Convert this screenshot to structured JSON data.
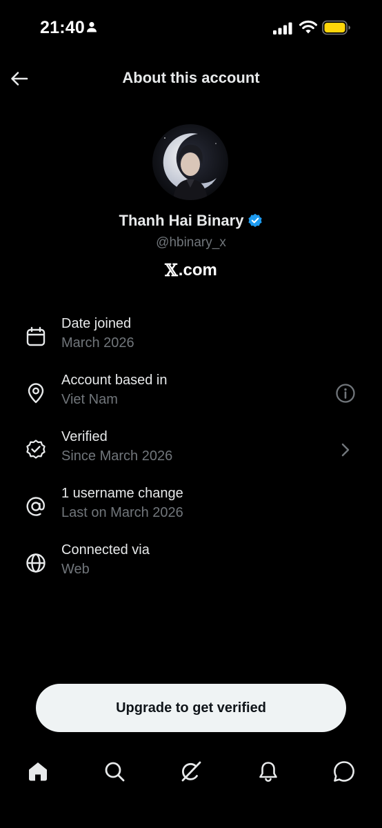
{
  "status_bar": {
    "time": "21:40",
    "battery_color": "#ffd60a"
  },
  "header": {
    "title": "About this account",
    "back_icon": "arrow-left-icon"
  },
  "profile": {
    "display_name": "Thanh Hai Binary",
    "handle": "@hbinary_x",
    "verified": true,
    "verified_color": "#1d9bf0",
    "platform_logo": "𝕏",
    "platform_domain": ".com"
  },
  "details": [
    {
      "icon": "calendar-icon",
      "title": "Date joined",
      "subtitle": "March 2026",
      "trailing": ""
    },
    {
      "icon": "location-pin-icon",
      "title": "Account based in",
      "subtitle": "Viet Nam",
      "trailing": "info-icon"
    },
    {
      "icon": "verified-badge-outline-icon",
      "title": "Verified",
      "subtitle": "Since March 2026",
      "trailing": "chevron-right-icon"
    },
    {
      "icon": "at-sign-icon",
      "title": "1 username change",
      "subtitle": "Last on March 2026",
      "trailing": ""
    },
    {
      "icon": "globe-icon",
      "title": "Connected via",
      "subtitle": "Web",
      "trailing": ""
    }
  ],
  "cta": {
    "label": "Upgrade to get verified"
  },
  "bottom_nav": [
    {
      "icon": "home-icon",
      "active": true
    },
    {
      "icon": "search-icon",
      "active": false
    },
    {
      "icon": "grok-icon",
      "active": false
    },
    {
      "icon": "bell-icon",
      "active": false
    },
    {
      "icon": "messages-icon",
      "active": false
    }
  ],
  "colors": {
    "background": "#000000",
    "primary_text": "#e7e9ea",
    "secondary_text": "#71767b",
    "button_bg": "#eff3f4",
    "button_text": "#0f1419"
  }
}
